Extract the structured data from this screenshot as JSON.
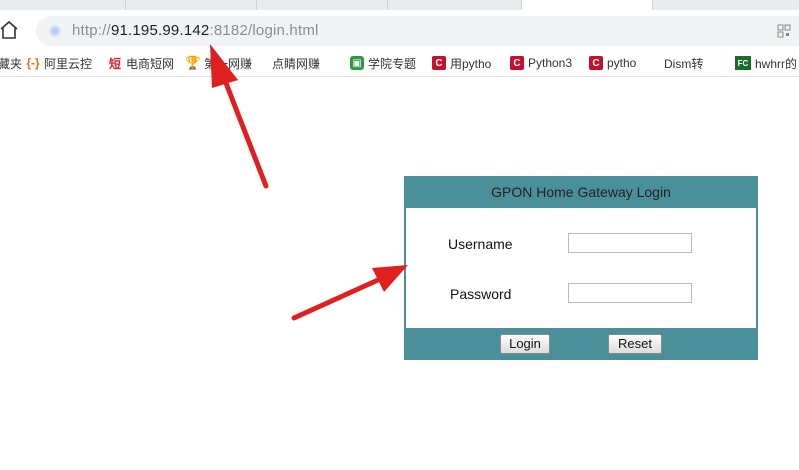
{
  "browser": {
    "url_prefix": "http://",
    "url_host": "91.195.99.142",
    "url_suffix": ":8182/login.html"
  },
  "bookmarks": [
    {
      "label": "藏夹",
      "icon": "none"
    },
    {
      "label": "阿里云控",
      "icon": "aliyun-icon"
    },
    {
      "label": "电商短网",
      "icon": "duan-icon"
    },
    {
      "label": "第一网赚",
      "icon": "trophy-icon"
    },
    {
      "label": "点睛网赚",
      "icon": "page-icon"
    },
    {
      "label": "学院专题",
      "icon": "camera-icon"
    },
    {
      "label": "用pytho",
      "icon": "c-icon"
    },
    {
      "label": "Python3",
      "icon": "c-icon"
    },
    {
      "label": "pytho",
      "icon": "c-icon"
    },
    {
      "label": "Dism转",
      "icon": "page-icon"
    },
    {
      "label": "hwhrr的",
      "icon": "fc-icon"
    }
  ],
  "login": {
    "title": "GPON Home Gateway Login",
    "username_label": "Username",
    "password_label": "Password",
    "username_value": "",
    "password_value": "",
    "login_button": "Login",
    "reset_button": "Reset"
  },
  "colors": {
    "login_frame": "#4b8f9b",
    "arrow": "#e02020"
  }
}
